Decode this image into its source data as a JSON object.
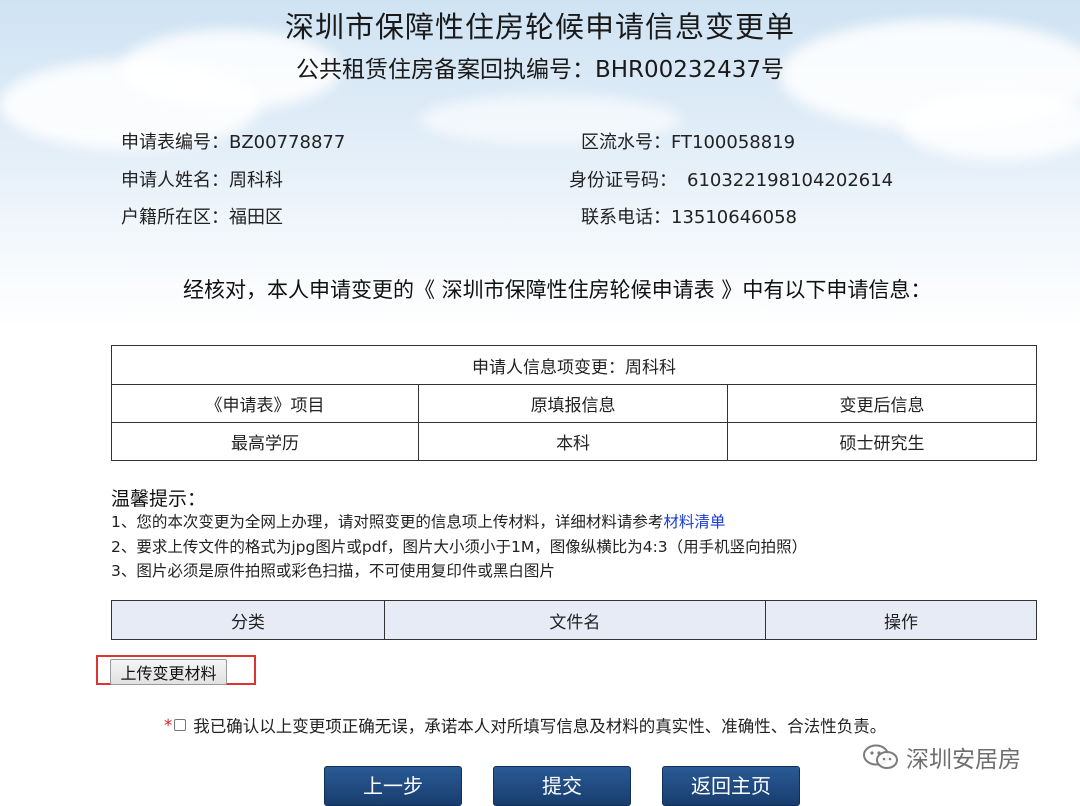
{
  "header": {
    "title": "深圳市保障性住房轮候申请信息变更单",
    "subtitle": "公共租赁住房备案回执编号：BHR00232437号"
  },
  "info": {
    "application_no_label": "申请表编号：",
    "application_no": "BZ00778877",
    "district_serial_label": "区流水号：",
    "district_serial": "FT100058819",
    "applicant_name_label": "申请人姓名：",
    "applicant_name": "周科科",
    "id_number_label": "身份证号码：",
    "id_number": "610322198104202614",
    "household_district_label": "户籍所在区：",
    "household_district": "福田区",
    "phone_label": "联系电话：",
    "phone": "13510646058"
  },
  "verify_text": "经核对，本人申请变更的《 深圳市保障性住房轮候申请表 》中有以下申请信息：",
  "change_table": {
    "caption": "申请人信息项变更：周科科",
    "headers": [
      "《申请表》项目",
      "原填报信息",
      "变更后信息"
    ],
    "rows": [
      [
        "最高学历",
        "本科",
        "硕士研究生"
      ]
    ]
  },
  "tips": {
    "title": "温馨提示：",
    "tip1": "1、您的本次变更为全网上办理，请对照变更的信息项上传材料，详细材料请参考",
    "tip1_link": "材料清单",
    "tip2": "2、要求上传文件的格式为jpg图片或pdf，图片大小须小于1M，图像纵横比为4:3（用手机竖向拍照）",
    "tip3": "3、图片必须是原件拍照或彩色扫描，不可使用复印件或黑白图片"
  },
  "file_table": {
    "headers": [
      "分类",
      "文件名",
      "操作"
    ]
  },
  "upload_button": "上传变更材料",
  "confirm": {
    "required_mark": "*",
    "text": "我已确认以上变更项正确无误，承诺本人对所填写信息及材料的真实性、准确性、合法性负责。"
  },
  "buttons": {
    "prev": "上一步",
    "submit": "提交",
    "home": "返回主页"
  },
  "watermark": "深圳安居房",
  "colors": {
    "button_bg": "#1f4a80",
    "link": "#1a3cd6",
    "highlight_border": "#dd3333",
    "table_header_bg": "#e7ebf6"
  }
}
